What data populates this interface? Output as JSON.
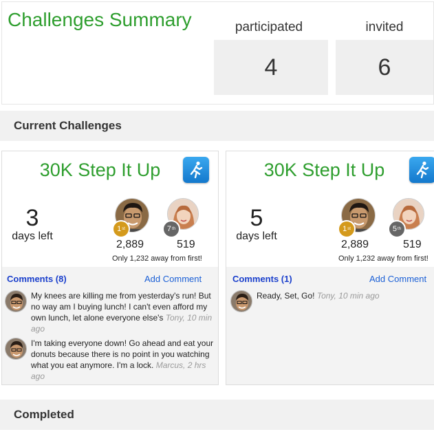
{
  "summary": {
    "title": "Challenges Summary",
    "participated_label": "participated",
    "participated_value": "4",
    "invited_label": "invited",
    "invited_value": "6"
  },
  "sections": {
    "current": "Current Challenges",
    "completed": "Completed"
  },
  "cards": [
    {
      "title": "30K Step It Up",
      "days_value": "3",
      "days_label": "days left",
      "leader_rank": "1",
      "leader_rank_suffix": "st",
      "leader_score": "2,889",
      "user_rank": "7",
      "user_rank_suffix": "th",
      "user_score": "519",
      "away_text": "Only 1,232 away from first!",
      "comments_header": "Comments (8)",
      "add_comment": "Add Comment",
      "comments": [
        {
          "text": "My knees are killing me from yesterday's run! But no way am I buying lunch! I can't even afford my own lunch, let alone everyone else's",
          "meta": "Tony, 10 min ago"
        },
        {
          "text": "I'm taking everyone down! Go ahead and eat your donuts because there is no point in you watching what you eat anymore. I'm a lock.",
          "meta": "Marcus, 2 hrs ago"
        }
      ]
    },
    {
      "title": "30K Step It Up",
      "days_value": "5",
      "days_label": "days left",
      "leader_rank": "1",
      "leader_rank_suffix": "st",
      "leader_score": "2,889",
      "user_rank": "5",
      "user_rank_suffix": "th",
      "user_score": "519",
      "away_text": "Only 1,232 away from first!",
      "comments_header": "Comments (1)",
      "add_comment": "Add Comment",
      "comments": [
        {
          "text": "Ready, Set, Go!",
          "meta": "Tony, 10 min ago"
        }
      ]
    }
  ],
  "colors": {
    "title_green": "#2e9e2e",
    "link_blue": "#1a5fd6",
    "gold_badge": "#d49a1c",
    "gray_badge": "#666666",
    "run_icon_blue": "#1f8ee0"
  },
  "icons": {
    "run": "running-man-icon",
    "avatar_male": "avatar-photo-male",
    "avatar_female": "avatar-photo-female"
  }
}
